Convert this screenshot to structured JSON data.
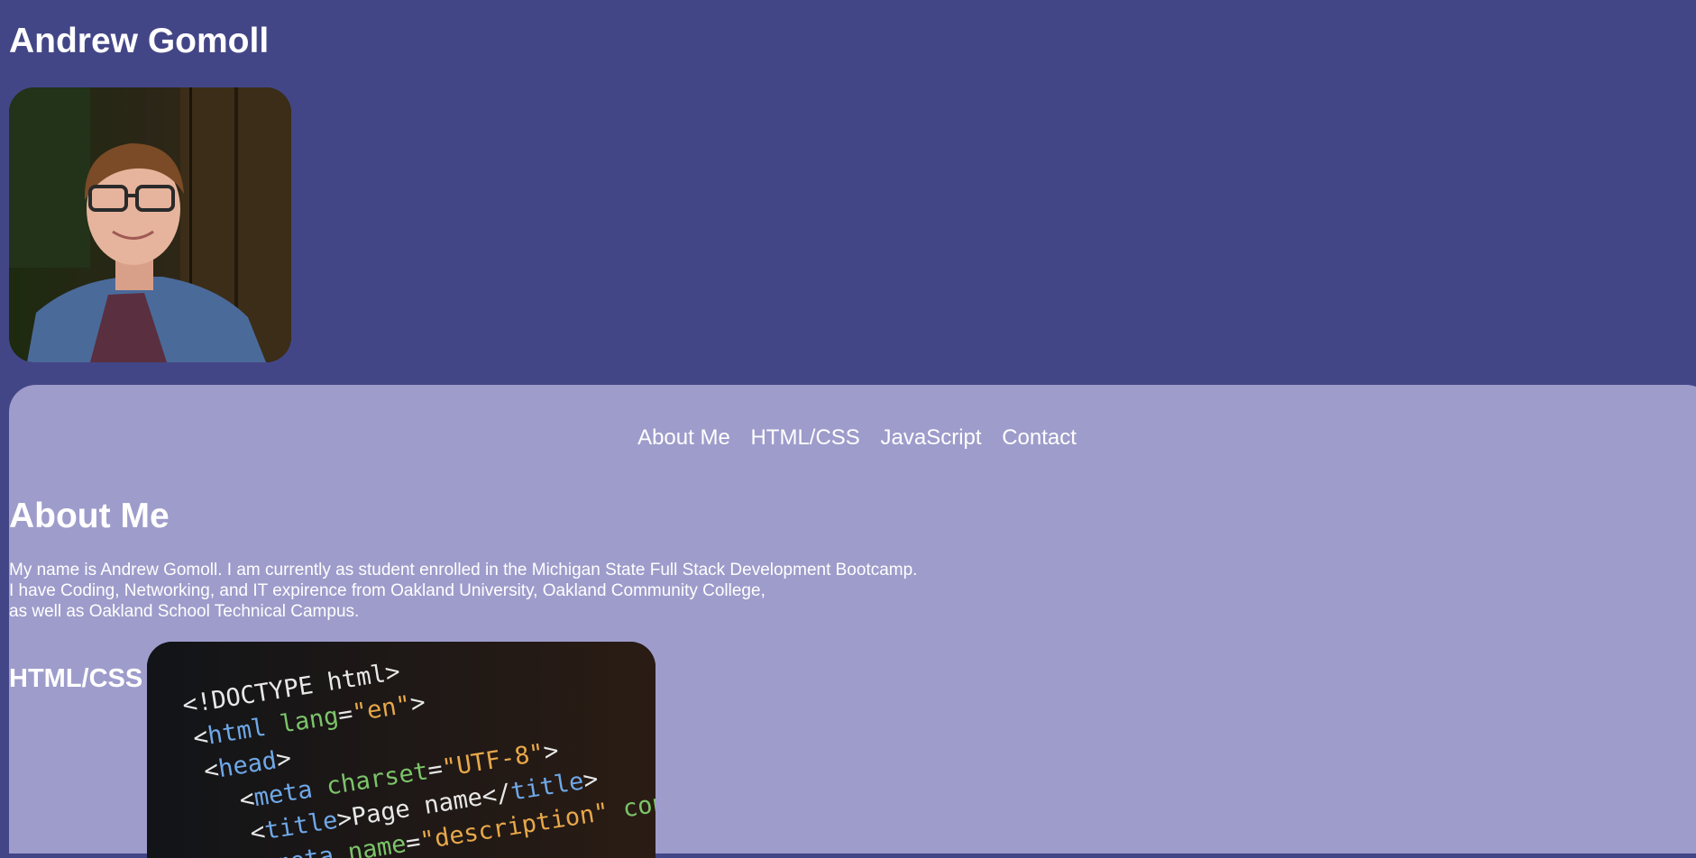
{
  "header": {
    "title": "Andrew Gomoll",
    "profile_image": "profile-photo"
  },
  "nav": {
    "items": [
      {
        "label": "About Me"
      },
      {
        "label": "HTML/CSS"
      },
      {
        "label": "JavaScript"
      },
      {
        "label": "Contact"
      }
    ]
  },
  "about": {
    "heading": "About Me",
    "lines": [
      "My name is Andrew Gomoll. I am currently as student enrolled in the Michigan State Full Stack Development Bootcamp.",
      "I have Coding, Networking, and IT expirence from Oakland University, Oakland Community College,",
      "as well as Oakland School Technical Campus."
    ]
  },
  "html_css": {
    "heading": "HTML/CSS",
    "code_lines": [
      {
        "text": "<!DOCTYPE html>"
      },
      {
        "text": "<html lang=\"en\">"
      },
      {
        "text": "<head>"
      },
      {
        "text": "<meta charset=\"UTF-8\">"
      },
      {
        "text": "<title>Page name</title>"
      },
      {
        "text": "<meta name=\"description\" content=\"...\">"
      }
    ]
  },
  "colors": {
    "page_bg": "#434686",
    "section_bg": "#9e9ccb",
    "text": "#ffffff"
  }
}
